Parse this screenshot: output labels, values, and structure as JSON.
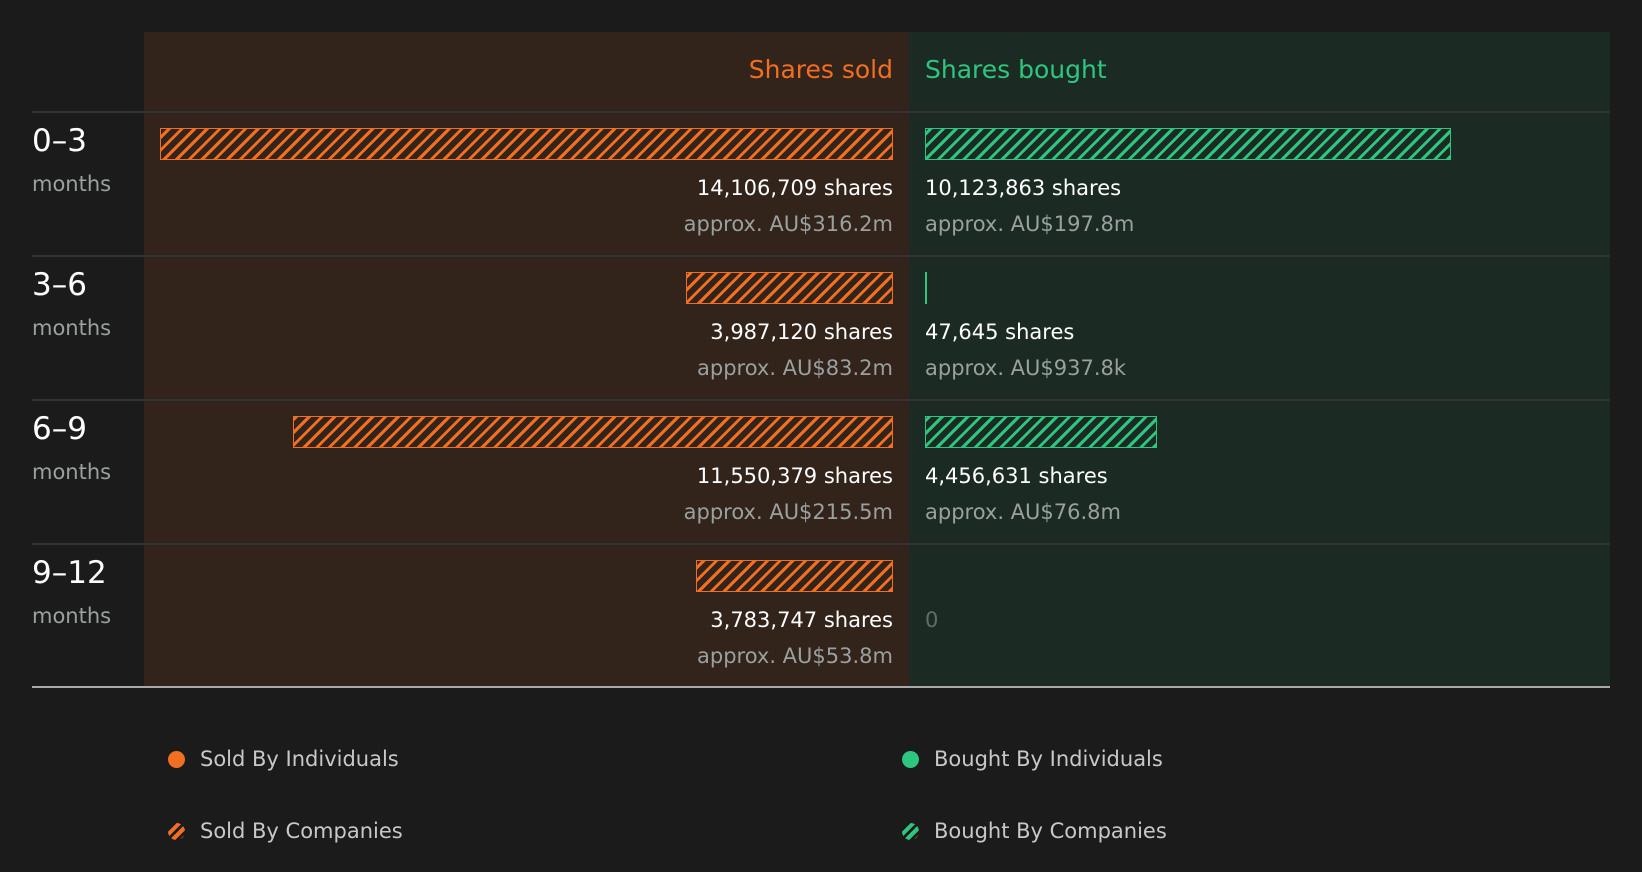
{
  "colors": {
    "sold": "#f26f21",
    "bought": "#2ec67f"
  },
  "chart_data": {
    "type": "bar",
    "headers": {
      "sold": "Shares sold",
      "bought": "Shares bought"
    },
    "categories": [
      {
        "period": "0–3",
        "unit": "months"
      },
      {
        "period": "3–6",
        "unit": "months"
      },
      {
        "period": "6–9",
        "unit": "months"
      },
      {
        "period": "9–12",
        "unit": "months"
      }
    ],
    "series": [
      {
        "name": "Shares sold",
        "values": [
          14106709,
          3987120,
          11550379,
          3783747
        ],
        "labels": [
          "14,106,709 shares",
          "3,987,120 shares",
          "11,550,379 shares",
          "3,783,747 shares"
        ],
        "approx": [
          "approx. AU$316.2m",
          "approx. AU$83.2m",
          "approx. AU$215.5m",
          "approx. AU$53.8m"
        ]
      },
      {
        "name": "Shares bought",
        "values": [
          10123863,
          47645,
          4456631,
          0
        ],
        "labels": [
          "10,123,863 shares",
          "47,645 shares",
          "4,456,631 shares",
          "0"
        ],
        "approx": [
          "approx. AU$197.8m",
          "approx. AU$937.8k",
          "approx. AU$76.8m",
          ""
        ]
      }
    ]
  },
  "legend": [
    {
      "label": "Sold By Individuals",
      "icon": "solid-dot",
      "color": "#f26f21"
    },
    {
      "label": "Bought By Individuals",
      "icon": "solid-dot",
      "color": "#2ec67f"
    },
    {
      "label": "Sold By Companies",
      "icon": "hatched-dot",
      "color": "#f26f21"
    },
    {
      "label": "Bought By Companies",
      "icon": "hatched-dot",
      "color": "#2ec67f"
    }
  ]
}
